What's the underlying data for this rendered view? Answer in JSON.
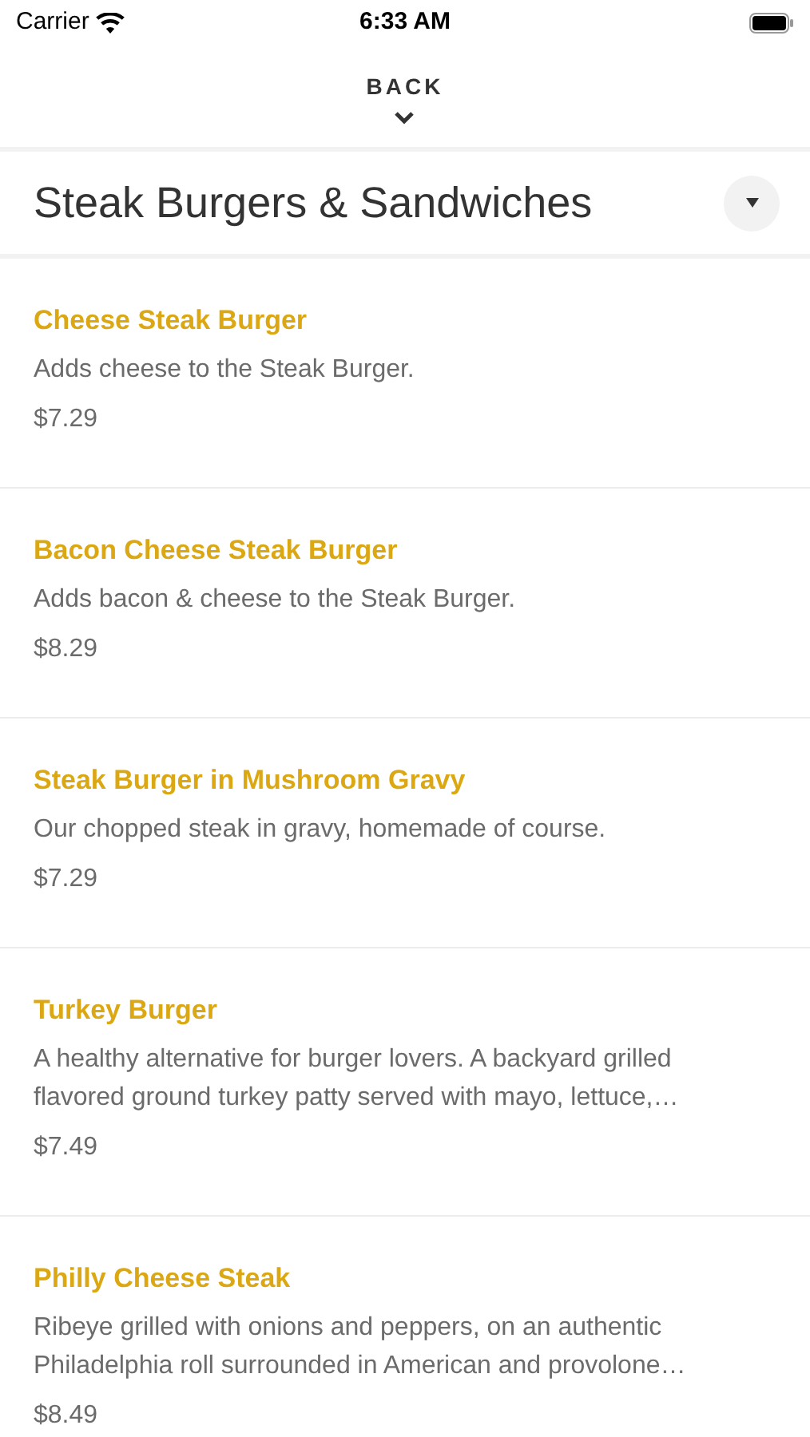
{
  "status_bar": {
    "carrier": "Carrier",
    "time": "6:33 AM"
  },
  "back": {
    "label": "BACK"
  },
  "category": {
    "title": "Steak Burgers & Sandwiches"
  },
  "items": [
    {
      "name": "Cheese Steak Burger",
      "description": "Adds cheese to the Steak Burger.",
      "price": "$7.29"
    },
    {
      "name": "Bacon Cheese Steak Burger",
      "description": "Adds bacon & cheese to the Steak Burger.",
      "price": "$8.29"
    },
    {
      "name": "Steak Burger in Mushroom Gravy",
      "description": "Our chopped steak in gravy, homemade of course.",
      "price": "$7.29"
    },
    {
      "name": "Turkey Burger",
      "description": "A healthy alternative for burger lovers. A backyard grilled flavored ground turkey patty served with mayo, lettuce,…",
      "price": "$7.49"
    },
    {
      "name": "Philly Cheese Steak",
      "description": "Ribeye grilled with onions and peppers, on an authentic Philadelphia roll surrounded in American and provolone…",
      "price": "$8.49"
    }
  ]
}
